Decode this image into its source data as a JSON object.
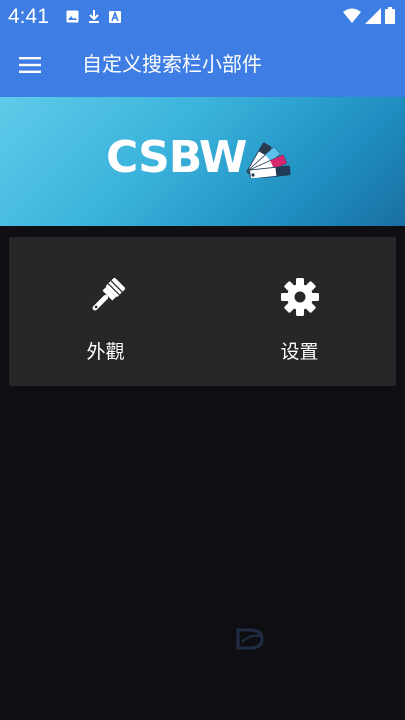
{
  "status_bar": {
    "time": "4:41",
    "left_icons": [
      "image-icon",
      "download-icon",
      "a-badge-icon"
    ],
    "right_icons": [
      "wifi-icon",
      "signal-icon",
      "battery-icon"
    ]
  },
  "app_bar": {
    "menu_icon": "hamburger-menu-icon",
    "title": "自定义搜索栏小部件"
  },
  "banner": {
    "logo_text": "CSBW",
    "logo_icon": "color-swatch-icon"
  },
  "tiles": [
    {
      "label": "外觀",
      "icon": "paintbrush-icon"
    },
    {
      "label": "设置",
      "icon": "gear-icon"
    }
  ],
  "colors": {
    "primary": "#3d7de4",
    "background": "#0f0e12",
    "card": "#272629",
    "banner_light": "#5fcbe9",
    "banner_dark": "#1a6fa2"
  }
}
